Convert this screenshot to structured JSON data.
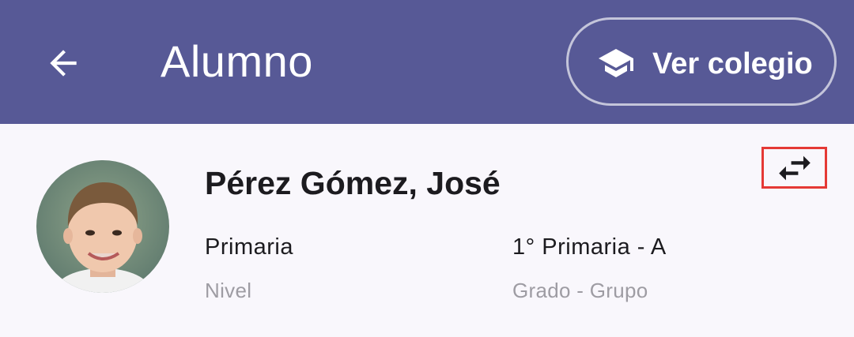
{
  "header": {
    "title": "Alumno",
    "back_icon": "arrow-back-icon",
    "school_button": {
      "label": "Ver colegio",
      "icon": "school-cap-icon"
    }
  },
  "student": {
    "name": "Pérez Gómez, José",
    "avatar": "student-photo",
    "level": {
      "value": "Primaria",
      "caption": "Nivel"
    },
    "grade_group": {
      "value": "1° Primaria - A",
      "caption": "Grado - Grupo"
    },
    "switch_icon": "swap-horiz-icon"
  },
  "colors": {
    "appbar": "#575996",
    "background": "#f9f7fc",
    "text_primary": "#1c1b1f",
    "text_secondary": "#9e9ca3",
    "highlight": "#e53935"
  }
}
